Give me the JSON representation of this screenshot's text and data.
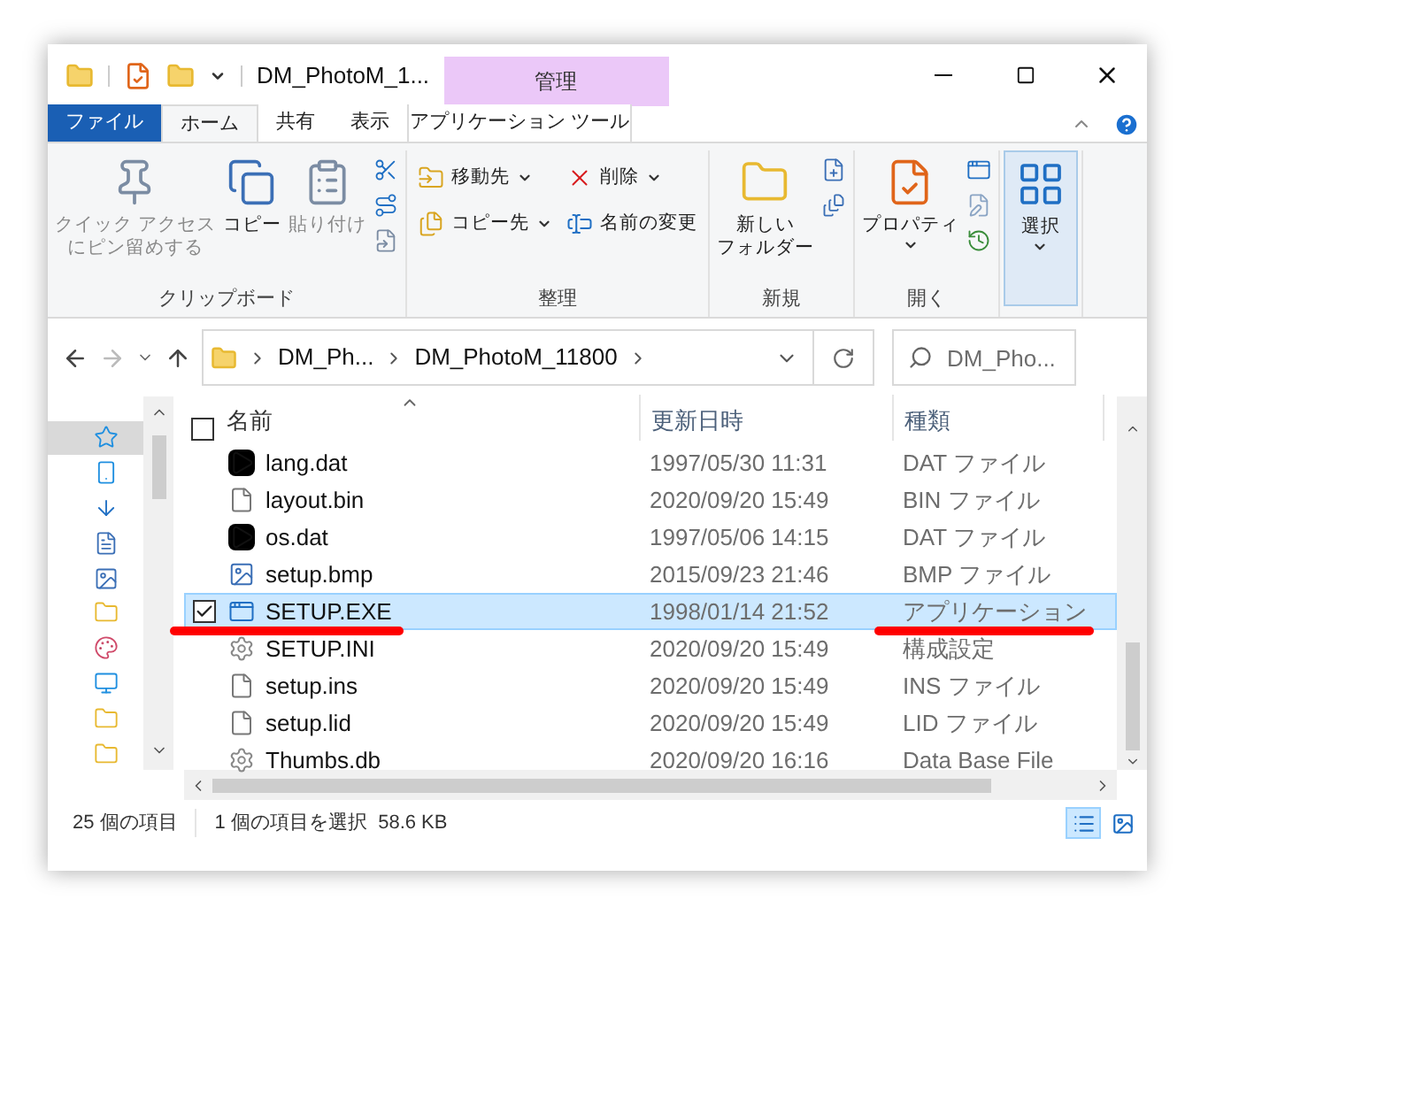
{
  "window": {
    "title": "DM_PhotoM_1...",
    "context_tab": "管理"
  },
  "tabs": [
    {
      "label": "ファイル",
      "kind": "file",
      "selected": false
    },
    {
      "label": "ホーム",
      "kind": "tab",
      "selected": true
    },
    {
      "label": "共有",
      "kind": "tab",
      "selected": false
    },
    {
      "label": "表示",
      "kind": "tab",
      "selected": false
    },
    {
      "label": "アプリケーション ツール",
      "kind": "context",
      "selected": false
    }
  ],
  "ribbon": {
    "groups": [
      {
        "label": "クリップボード",
        "items": [
          {
            "kind": "large",
            "lines": [
              "クイック アクセス",
              "にピン留めする"
            ],
            "disabled": true
          },
          {
            "kind": "large",
            "lines": [
              "コピー"
            ],
            "disabled": false
          },
          {
            "kind": "large",
            "lines": [
              "貼り付け"
            ],
            "disabled": true
          },
          {
            "kind": "stack"
          }
        ]
      },
      {
        "label": "整理",
        "items": [
          {
            "kind": "column",
            "buttons": [
              {
                "label": "移動先",
                "dropdown": true
              },
              {
                "label": "コピー先",
                "dropdown": true
              }
            ]
          },
          {
            "kind": "column",
            "buttons": [
              {
                "label": "削除",
                "dropdown": true
              },
              {
                "label": "名前の変更",
                "dropdown": false
              }
            ]
          }
        ]
      },
      {
        "label": "新規",
        "items": [
          {
            "kind": "large",
            "lines": [
              "新しい",
              "フォルダー"
            ],
            "disabled": false
          },
          {
            "kind": "stack"
          }
        ]
      },
      {
        "label": "開く",
        "items": [
          {
            "kind": "large",
            "lines": [
              "プロパティ"
            ],
            "disabled": false,
            "dropdown": true
          },
          {
            "kind": "stack"
          }
        ]
      },
      {
        "items": [
          {
            "kind": "collapsed",
            "lines": [
              "選択"
            ],
            "dropdown": true
          }
        ]
      }
    ]
  },
  "address": {
    "crumbs": [
      "DM_Ph...",
      "DM_PhotoM_11800"
    ],
    "search_placeholder": "DM_Pho..."
  },
  "select_all": {
    "checked": false
  },
  "columns": [
    {
      "label": "名前",
      "sorted": true
    },
    {
      "label": "更新日時",
      "sorted": false
    },
    {
      "label": "種類",
      "sorted": false
    }
  ],
  "rows": [
    {
      "name": "lang.dat",
      "date": "1997/05/30 11:31",
      "type": "DAT ファイル",
      "kind": "media",
      "selected": false,
      "checked": false,
      "underlined": false
    },
    {
      "name": "layout.bin",
      "date": "2020/09/20 15:49",
      "type": "BIN ファイル",
      "kind": "blank",
      "selected": false,
      "checked": false,
      "underlined": false
    },
    {
      "name": "os.dat",
      "date": "1997/05/06 14:15",
      "type": "DAT ファイル",
      "kind": "media",
      "selected": false,
      "checked": false,
      "underlined": false
    },
    {
      "name": "setup.bmp",
      "date": "2015/09/23 21:46",
      "type": "BMP ファイル",
      "kind": "image",
      "selected": false,
      "checked": false,
      "underlined": false
    },
    {
      "name": "SETUP.EXE",
      "date": "1998/01/14 21:52",
      "type": "アプリケーション",
      "kind": "app",
      "selected": true,
      "checked": true,
      "underlined": true
    },
    {
      "name": "SETUP.INI",
      "date": "2020/09/20 15:49",
      "type": "構成設定",
      "kind": "settings",
      "selected": false,
      "checked": false,
      "underlined": false
    },
    {
      "name": "setup.ins",
      "date": "2020/09/20 15:49",
      "type": "INS ファイル",
      "kind": "blank",
      "selected": false,
      "checked": false,
      "underlined": false
    },
    {
      "name": "setup.lid",
      "date": "2020/09/20 15:49",
      "type": "LID ファイル",
      "kind": "blank",
      "selected": false,
      "checked": false,
      "underlined": false
    },
    {
      "name": "Thumbs.db",
      "date": "2020/09/20 16:16",
      "type": "Data Base File",
      "kind": "settings",
      "selected": false,
      "checked": false,
      "underlined": false
    }
  ],
  "nav": [
    {
      "selected": true
    },
    {
      "selected": false
    },
    {
      "selected": false
    },
    {
      "selected": false
    },
    {
      "selected": false
    },
    {
      "selected": false
    },
    {
      "selected": false
    },
    {
      "selected": false
    },
    {
      "selected": false
    },
    {
      "selected": false
    }
  ],
  "status": {
    "count": "25 個の項目",
    "selection": "1 個の項目を選択  58.6 KB"
  },
  "views": [
    {
      "kind": "details",
      "selected": true
    },
    {
      "kind": "large",
      "selected": false
    }
  ]
}
